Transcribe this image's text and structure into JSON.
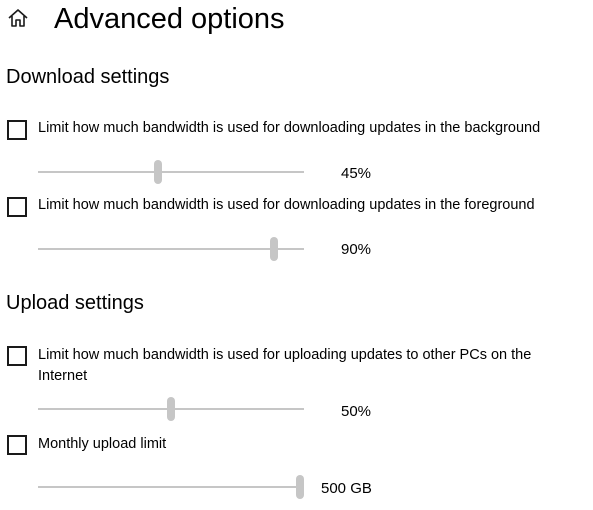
{
  "header": {
    "icon": "home-icon",
    "title": "Advanced options"
  },
  "download": {
    "title": "Download settings",
    "background": {
      "label": "Limit how much bandwidth is used for downloading updates in the background",
      "checked": false,
      "value": 45,
      "value_text": "45%"
    },
    "foreground": {
      "label": "Limit how much bandwidth is used for downloading updates in the foreground",
      "checked": false,
      "value": 90,
      "value_text": "90%"
    }
  },
  "upload": {
    "title": "Upload settings",
    "internet": {
      "label": "Limit how much bandwidth is used for uploading updates to other PCs on the Internet",
      "checked": false,
      "value": 50,
      "value_text": "50%"
    },
    "monthly": {
      "label": "Monthly upload limit",
      "checked": false,
      "value": 500,
      "max": 500,
      "value_text": "500 GB"
    }
  },
  "colors": {
    "disabled_slider": "#c6c6c6",
    "checkbox_border": "#1a1a1a"
  }
}
